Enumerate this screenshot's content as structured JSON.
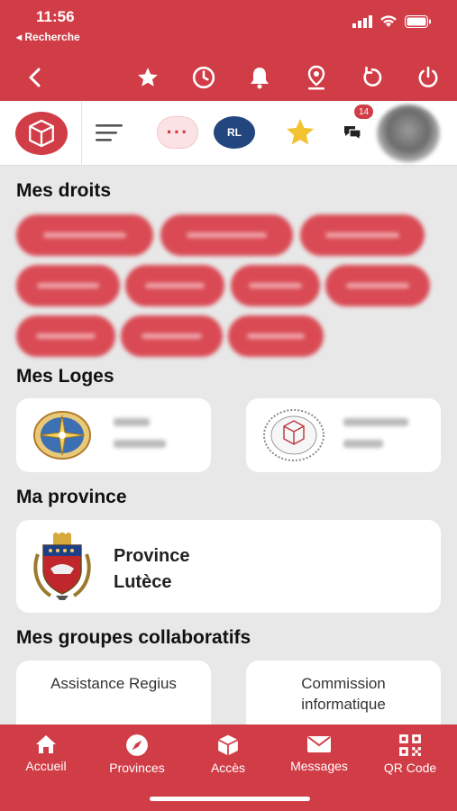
{
  "status_bar": {
    "time": "11:56",
    "back_label": "◂ Recherche"
  },
  "toolbar": {
    "icons": [
      "back-arrow-icon",
      "star-icon",
      "clock-icon",
      "bell-icon",
      "location-pin-icon",
      "refresh-icon",
      "power-icon"
    ]
  },
  "header": {
    "rl_label": "RL",
    "notification_count": "14",
    "more_label": "···"
  },
  "sections": {
    "droits_title": "Mes droits",
    "loges_title": "Mes Loges",
    "province_title": "Ma province",
    "groupes_title": "Mes groupes collaboratifs"
  },
  "province": {
    "line1": "Province",
    "line2": "Lutèce"
  },
  "groups": [
    {
      "label": "Assistance Regius"
    },
    {
      "label_line1": "Commission",
      "label_line2": "informatique"
    }
  ],
  "tabs": [
    {
      "label": "Accueil",
      "icon": "home-icon"
    },
    {
      "label": "Provinces",
      "icon": "compass-icon"
    },
    {
      "label": "Accès",
      "icon": "cube-icon"
    },
    {
      "label": "Messages",
      "icon": "envelope-icon"
    },
    {
      "label": "QR Code",
      "icon": "qr-code-icon"
    }
  ],
  "colors": {
    "brand_red": "#d13d47",
    "navy": "#23467e",
    "star_yellow": "#f2c230"
  }
}
